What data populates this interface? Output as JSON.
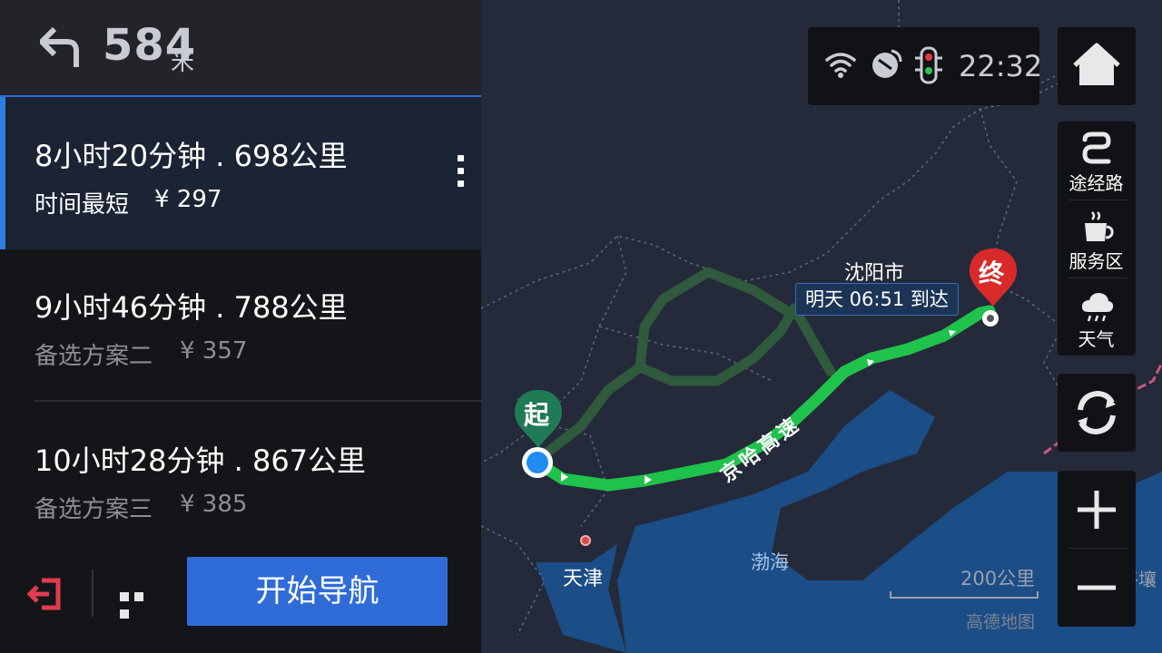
{
  "maneuver": {
    "icon": "turn-back-left-icon",
    "distance": "584",
    "unit": "米"
  },
  "routes": [
    {
      "main": "8小时20分钟 . 698公里",
      "label": "时间最短",
      "price": "¥ 297",
      "selected": true
    },
    {
      "main": "9小时46分钟 . 788公里",
      "label": "备选方案二",
      "price": "¥ 357",
      "selected": false
    },
    {
      "main": "10小时28分钟 . 867公里",
      "label": "备选方案三",
      "price": "¥ 385",
      "selected": false
    }
  ],
  "actions": {
    "start_label": "开始导航"
  },
  "status": {
    "time": "22:32",
    "icons": [
      "wifi-icon",
      "gps-icon",
      "traffic-light-icon"
    ]
  },
  "side_tools": {
    "waypoint_label": "途经路",
    "service_label": "服务区",
    "weather_label": "天气"
  },
  "map": {
    "start_marker": "起",
    "end_marker": "终",
    "city_shenyang": "沈阳市",
    "city_tianjin": "天津",
    "sea_bohai": "渤海",
    "highway": "京哈高速",
    "arrival": "明天 06:51 到达",
    "edge_label": "平壤",
    "scale": "200公里",
    "brand": "高德地图"
  },
  "colors": {
    "selected_route": "#1fc24b",
    "alt_route": "#2f5a3c",
    "sea": "#1b4d86",
    "start_marker": "#1f7b53",
    "end_marker": "#d92a2a",
    "start_button": "#2f6cd8",
    "accent": "#2b7fe6"
  }
}
